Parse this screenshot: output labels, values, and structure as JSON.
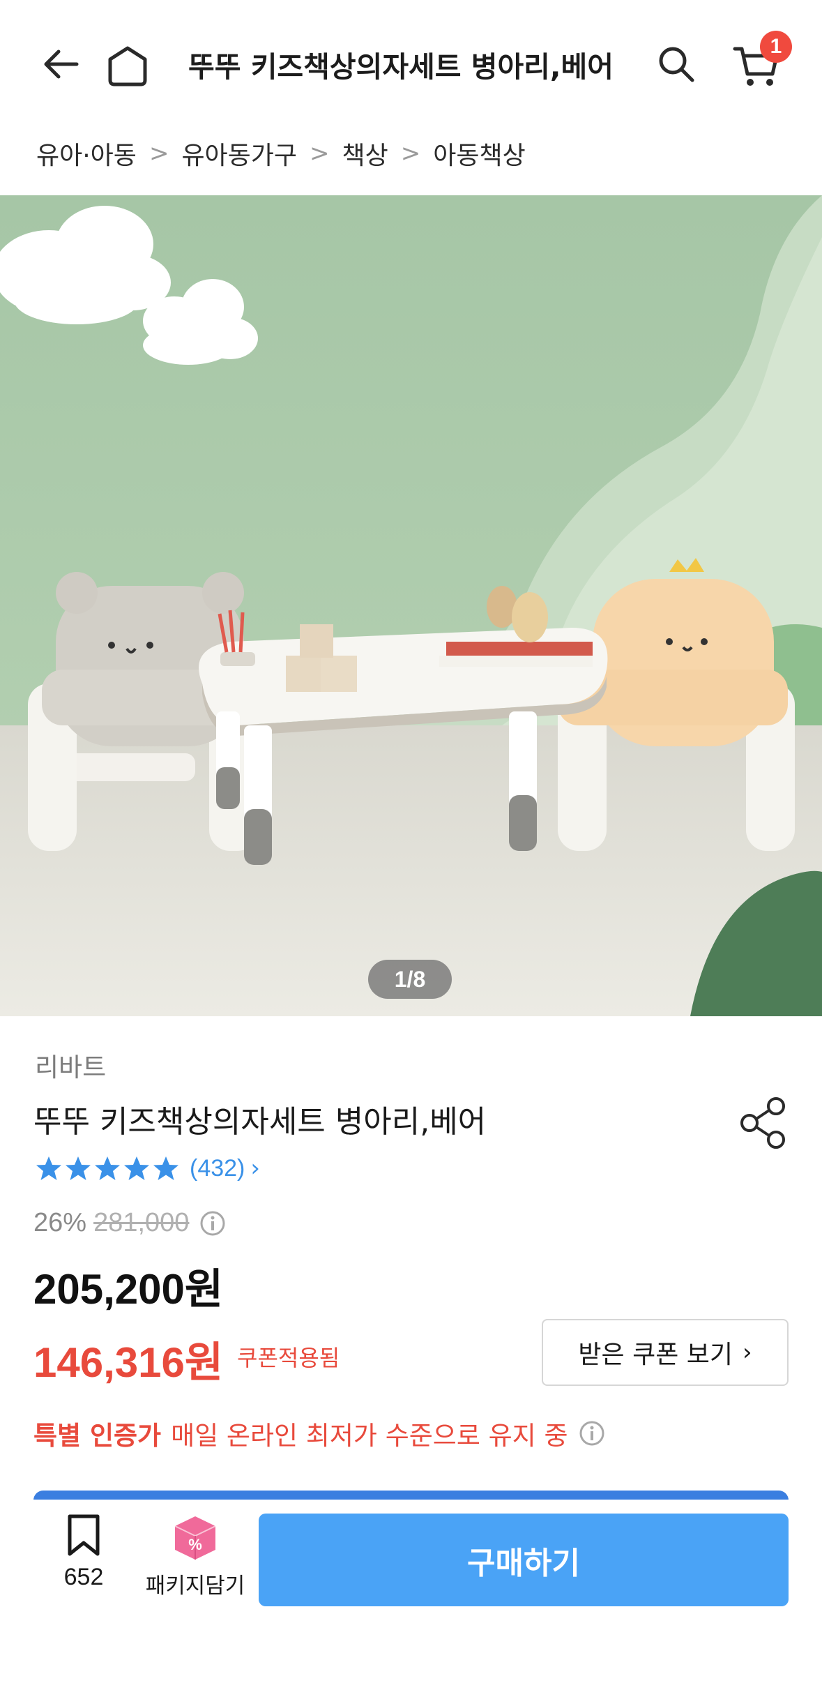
{
  "header": {
    "title": "뚜뚜 키즈책상의자세트 병아리,베어",
    "cart_count": "1",
    "icons": [
      "back-arrow-icon",
      "home-icon",
      "search-icon",
      "cart-icon"
    ]
  },
  "breadcrumb": {
    "items": [
      "유아·아동",
      "유아동가구",
      "책상",
      "아동책상"
    ],
    "separator": ">"
  },
  "gallery": {
    "pager": "1/8"
  },
  "product": {
    "brand": "리바트",
    "name": "뚜뚜 키즈책상의자세트 병아리,베어",
    "rating_stars": 5,
    "review_count": "(432)",
    "discount_rate": "26%",
    "original_price": "281,000",
    "price": "205,200원",
    "coupon_price": "146,316원",
    "coupon_applied_label": "쿠폰적용됨",
    "coupon_button_label": "받은 쿠폰 보기",
    "special_strong": "특별 인증가",
    "special_text": "매일 온라인 최저가 수준으로 유지 중"
  },
  "bottom_bar": {
    "bookmark_count": "652",
    "package_label": "패키지담기",
    "buy_label": "구매하기"
  },
  "colors": {
    "accent_blue": "#4aa3f6",
    "sale_red": "#e84a3c",
    "star_blue": "#3a91e8",
    "badge_red": "#f04a3e"
  }
}
